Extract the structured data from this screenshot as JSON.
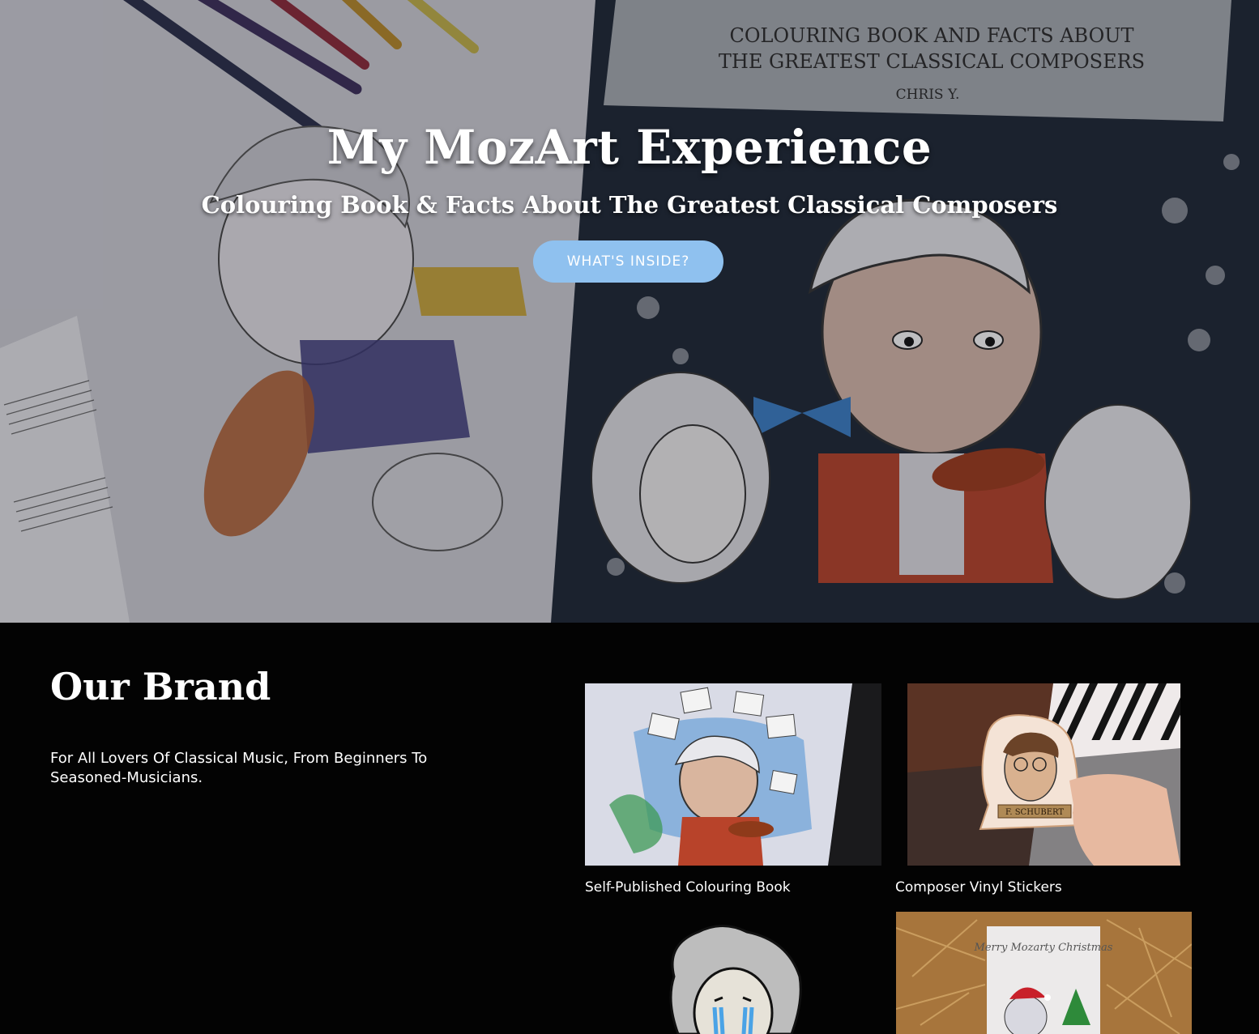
{
  "hero": {
    "title": "My MozArt Experience",
    "subtitle": "Colouring Book & Facts About The Greatest Classical Composers",
    "button_label": "WHAT'S INSIDE?",
    "background_image_text": {
      "line1": "COLOURING BOOK AND FACTS ABOUT",
      "line2": "THE GREATEST CLASSICAL COMPOSERS",
      "author": "CHRIS Y."
    }
  },
  "brand": {
    "title": "Our Brand",
    "description": "For All Lovers Of Classical Music, From Beginners To Seasoned-Musicians.",
    "products": [
      {
        "caption": "Self-Published Colouring Book"
      },
      {
        "caption": "Composer Vinyl Stickers",
        "sticker_label": "F. SCHUBERT"
      },
      {
        "caption": ""
      },
      {
        "caption": "",
        "card_text": "Merry Mozarty Christmas"
      }
    ]
  },
  "colors": {
    "button": "#8fc1ef",
    "section_bg": "#030303",
    "text": "#ffffff"
  }
}
